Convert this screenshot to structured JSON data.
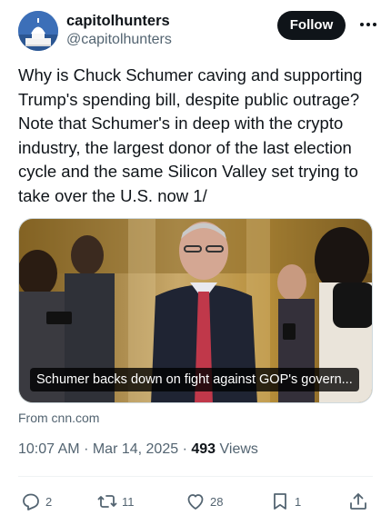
{
  "author": {
    "display_name": "capitolhunters",
    "handle": "@capitolhunters"
  },
  "follow_label": "Follow",
  "tweet_text": "Why is Chuck Schumer caving and supporting Trump's spending bill, despite public outrage? Note that Schumer's in deep with the crypto industry, the largest donor of the last election cycle and the same Silicon Valley set trying to take over the U.S. now 1/",
  "link_card": {
    "caption": "Schumer backs down on fight against GOP's govern...",
    "source": "From cnn.com"
  },
  "meta": {
    "time": "10:07 AM",
    "date": "Mar 14, 2025",
    "views_count": "493",
    "views_label": "Views"
  },
  "actions": {
    "replies": "2",
    "reposts": "11",
    "likes": "28",
    "bookmarks": "1"
  },
  "icons": [
    "capitol-dome-avatar",
    "more-icon",
    "reply-icon",
    "repost-icon",
    "like-icon",
    "bookmark-icon",
    "share-icon"
  ],
  "colors": {
    "text": "#0f1419",
    "secondary": "#536471",
    "follow_bg": "#0f1419"
  }
}
